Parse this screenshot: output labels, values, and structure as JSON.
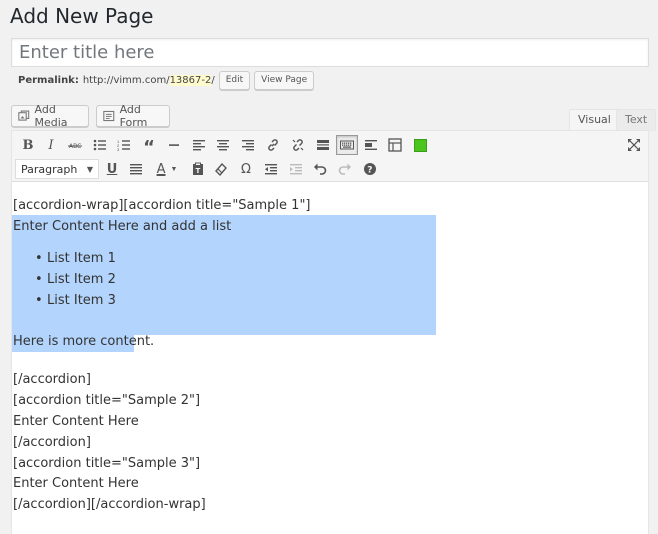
{
  "page": {
    "title": "Add New Page"
  },
  "title_field": {
    "placeholder": "Enter title here"
  },
  "permalink": {
    "label": "Permalink:",
    "url_base": "http://vimm.com/",
    "slug": "13867-2",
    "suffix": "/",
    "edit_label": "Edit",
    "view_label": "View Page"
  },
  "media_buttons": {
    "add_media": "Add Media",
    "add_form": "Add Form"
  },
  "tabs": {
    "visual": "Visual",
    "text": "Text"
  },
  "toolbar": {
    "format_select": "Paragraph",
    "accent_color": "#4bc51d"
  },
  "content": {
    "lines": [
      "[accordion-wrap][accordion title=\"Sample 1\"]",
      "Enter Content Here and add a list",
      "Here is more content.",
      "[/accordion]",
      "[accordion title=\"Sample 2\"]",
      "Enter Content Here",
      "[/accordion]",
      "[accordion title=\"Sample 3\"]",
      "Enter Content Here",
      "[/accordion][/accordion-wrap]"
    ],
    "list_items": [
      "List Item 1",
      "List Item 2",
      "List Item 3"
    ]
  }
}
